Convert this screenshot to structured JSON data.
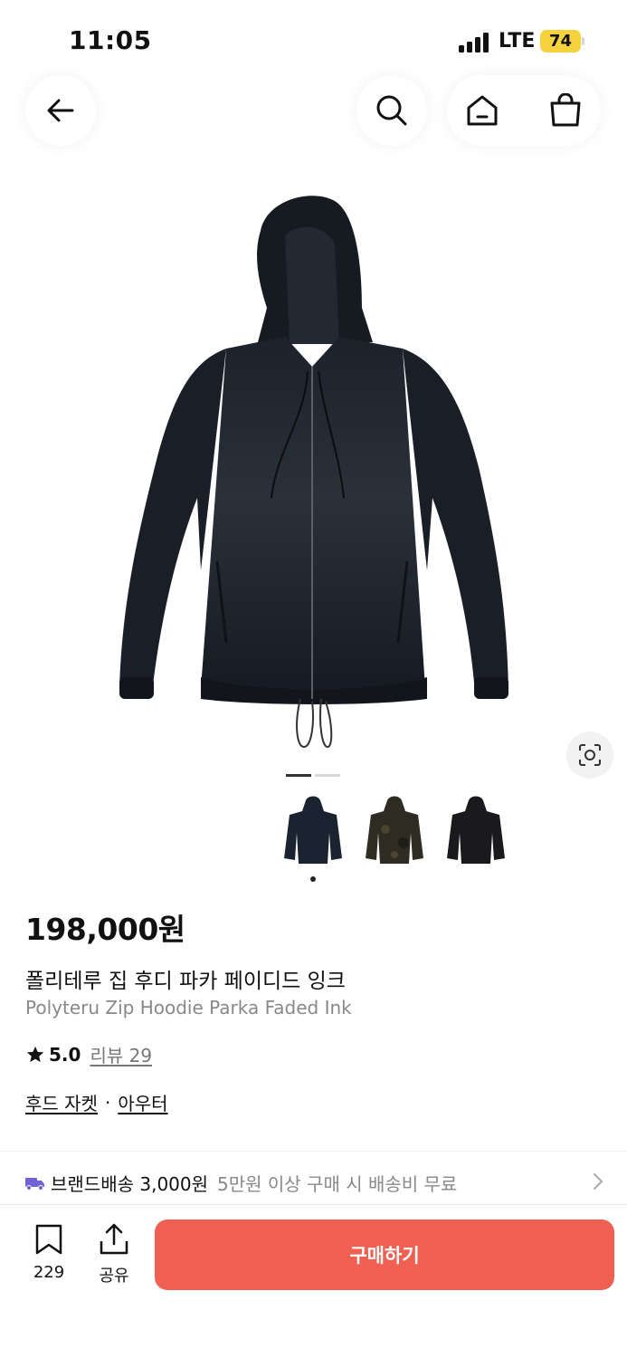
{
  "status": {
    "time": "11:05",
    "network": "LTE",
    "battery": "74"
  },
  "nav": {
    "back_icon": "arrow-left-icon",
    "search_icon": "search-icon",
    "home_icon": "home-icon",
    "cart_icon": "shopping-bag-icon"
  },
  "gallery": {
    "current_page": 1,
    "total_pages": 2,
    "thumbnails": [
      "black hoodie",
      "camo hoodie",
      "dark hoodie"
    ]
  },
  "product": {
    "price": "198,000원",
    "name_ko": "폴리테루 집 후디 파카 페이디드 잉크",
    "name_en": "Polyteru Zip Hoodie Parka Faded Ink",
    "rating": "5.0",
    "review_label": "리뷰 29",
    "category": [
      "후드 자켓",
      "아우터"
    ],
    "category_sep": "·"
  },
  "shipping": {
    "icon": "truck-icon",
    "label": "브랜드배송 3,000원",
    "condition": "5만원 이상 구매 시 배송비 무료"
  },
  "bottom": {
    "bookmark_count": "229",
    "share_label": "공유",
    "buy_label": "구매하기"
  },
  "colors": {
    "accent": "#ef5f52",
    "battery": "#f6d23f",
    "delivery_icon": "#6e63d9"
  }
}
